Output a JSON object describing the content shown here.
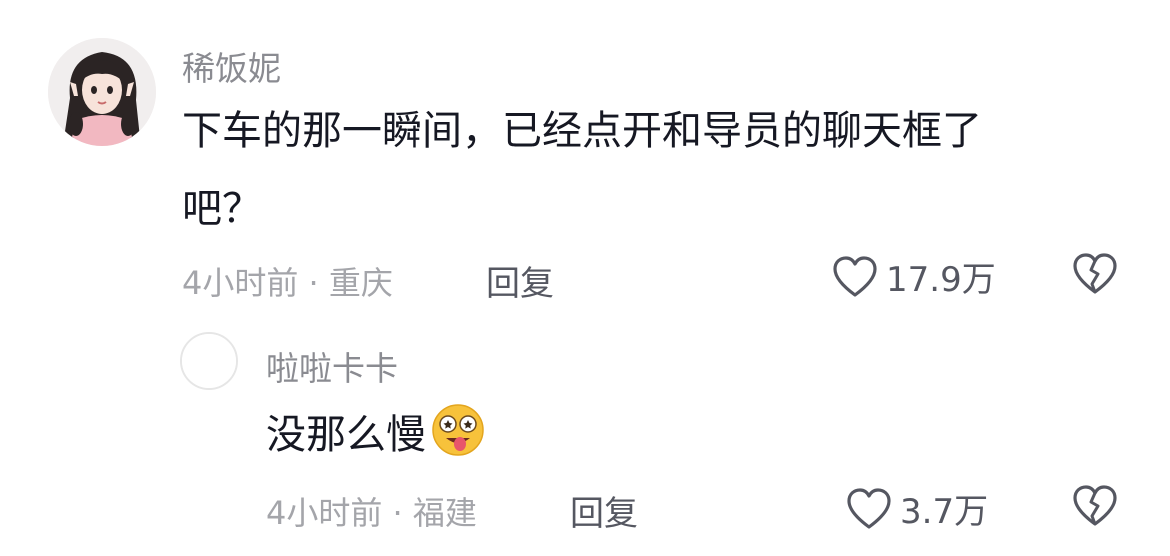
{
  "comments": [
    {
      "username": "稀饭妮",
      "text_line1": "下车的那一瞬间，已经点开和导员的聊天框了",
      "text_line2": "吧？",
      "meta": "4小时前 · 重庆",
      "reply_label": "回复",
      "likes": "17.9万",
      "avatar_icon": "anime-girl-avatar"
    },
    {
      "username": "啦啦卡卡",
      "text": "没那么慢",
      "emoji": "drooling-heart-eyes-emoji",
      "meta": "4小时前 · 福建",
      "reply_label": "回复",
      "likes": "3.7万",
      "avatar_icon": "blank-avatar"
    }
  ],
  "colors": {
    "text": "#161823",
    "secondary": "#8a8b91",
    "meta": "#a4a5aa",
    "action": "#555761"
  }
}
